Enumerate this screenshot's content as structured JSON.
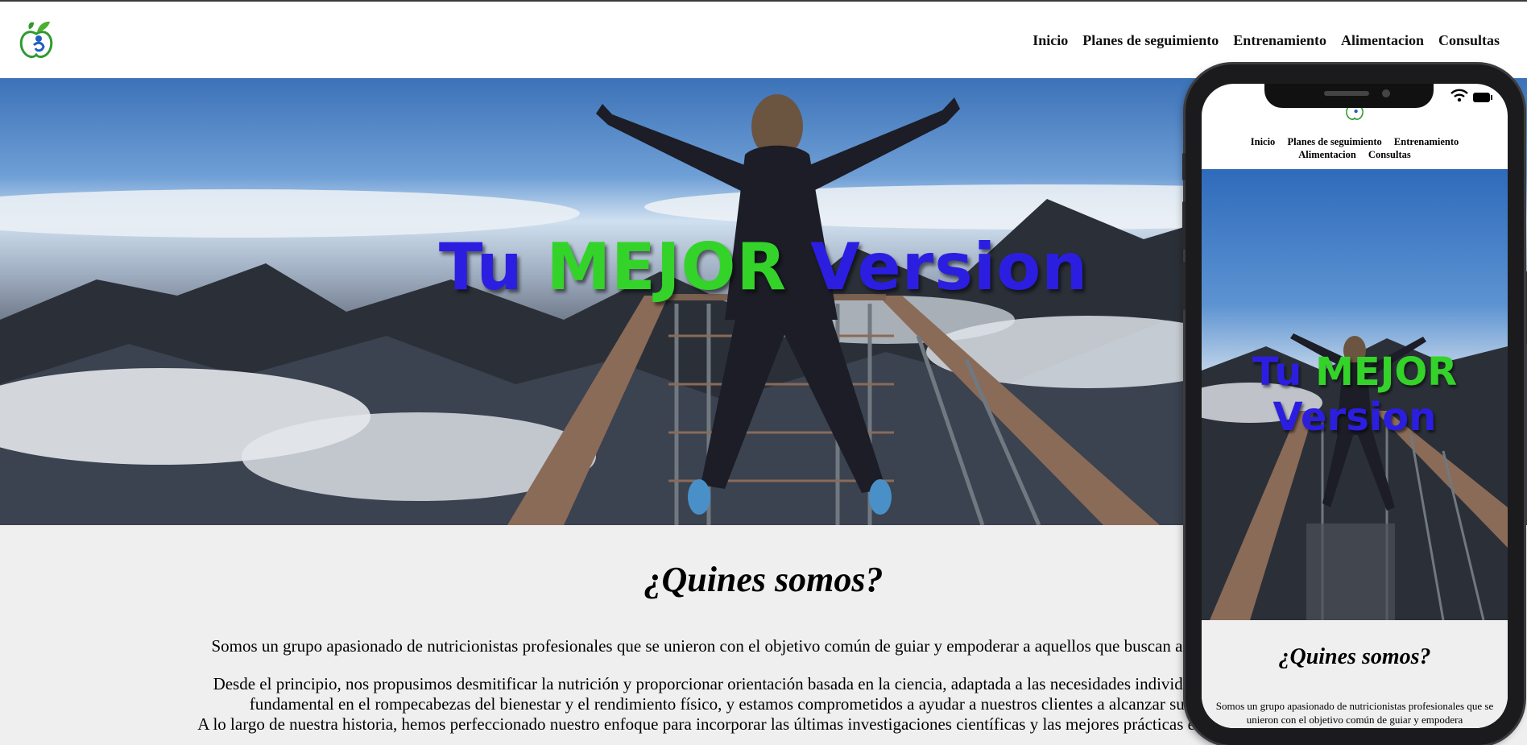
{
  "nav": {
    "logo_icon": "apple-leaf-logo-icon",
    "links": [
      "Inicio",
      "Planes de seguimiento",
      "Entrenamiento",
      "Alimentacion",
      "Consultas"
    ]
  },
  "hero": {
    "title_part1": "Tu",
    "title_part2": "MEJOR",
    "title_part3": "Version",
    "image": "woman-arms-raised-on-mountain-viewpoint",
    "colors": {
      "blue": "#2c1ee0",
      "green": "#34d32a"
    }
  },
  "about": {
    "title": "¿Quines somos?",
    "paragraph1": "Somos un grupo apasionado de nutricionistas profesionales que se unieron con el objetivo común de guiar y empoderar a aquellos que buscan alcanzar sus metas fi",
    "paragraph2_line1": "Desde el principio, nos propusimos desmitificar la nutrición y proporcionar orientación basada en la ciencia, adaptada a las necesidades individuales de cada perso",
    "paragraph2_line2": "fundamental en el rompecabezas del bienestar y el rendimiento físico, y estamos comprometidos a ayudar a nuestros clientes a alcanzar sus objetivos de",
    "paragraph3": "A lo largo de nuestra historia, hemos perfeccionado nuestro enfoque para incorporar las últimas investigaciones científicas y las mejores prácticas en nutrición deportiv"
  },
  "mobile": {
    "nav_line1": [
      "Inicio",
      "Planes de seguimiento",
      "Entrenamiento"
    ],
    "nav_line2": [
      "Alimentacion",
      "Consultas"
    ],
    "title_line1_part1": "Tu",
    "title_line1_part2": "MEJOR",
    "title_line2": "Version",
    "about_title": "¿Quines somos?",
    "about_text": "Somos un grupo apasionado de nutricionistas profesionales que se unieron con el objetivo común de guiar y empodera"
  }
}
